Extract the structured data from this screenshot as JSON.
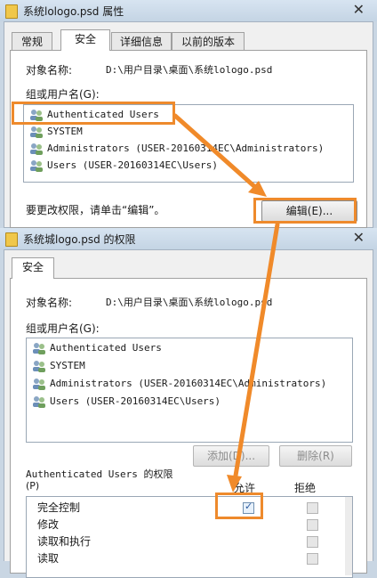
{
  "properties_window": {
    "title": "系统lologo.psd 属性",
    "tabs": [
      "常规",
      "安全",
      "详细信息",
      "以前的版本"
    ],
    "object_name_label": "对象名称:",
    "object_name_value": "D:\\用户目录\\桌面\\系统lologo.psd",
    "groups_label": "组或用户名(G):",
    "users": [
      "Authenticated Users",
      "SYSTEM",
      "Administrators (USER-20160314EC\\Administrators)",
      "Users (USER-20160314EC\\Users)"
    ],
    "change_hint": "要更改权限，请单击“编辑”。",
    "edit_button": "编辑(E)..."
  },
  "permissions_window": {
    "title": "系统城logo.psd 的权限",
    "tab": "安全",
    "object_name_label": "对象名称:",
    "object_name_value": "D:\\用户目录\\桌面\\系统lologo.psd",
    "groups_label": "组或用户名(G):",
    "users": [
      "Authenticated Users",
      "SYSTEM",
      "Administrators (USER-20160314EC\\Administrators)",
      "Users (USER-20160314EC\\Users)"
    ],
    "add_button": "添加(D)...",
    "remove_button": "删除(R)",
    "permissions_label_line1": "Authenticated Users 的权限",
    "permissions_label_line2": "(P)",
    "allow_header": "允许",
    "deny_header": "拒绝",
    "permissions": [
      {
        "name": "完全控制",
        "allow": true,
        "deny": false
      },
      {
        "name": "修改",
        "allow": false,
        "deny": false
      },
      {
        "name": "读取和执行",
        "allow": false,
        "deny": false
      },
      {
        "name": "读取",
        "allow": false,
        "deny": false
      }
    ]
  },
  "colors": {
    "highlight": "#ee8a2c",
    "arrow": "#f08a2a"
  }
}
